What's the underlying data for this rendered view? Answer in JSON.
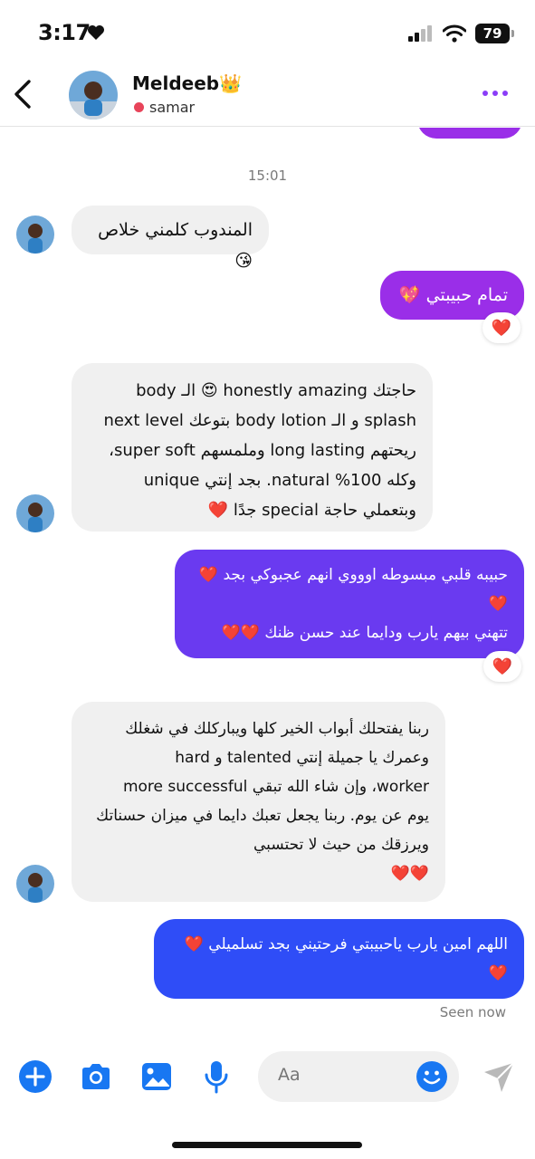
{
  "status_bar": {
    "time": "3:17",
    "battery": "79"
  },
  "header": {
    "contact_name": "Meldeeb👑",
    "contact_status": "samar",
    "accent_color": "#8b3df8"
  },
  "chat": {
    "timestamp": "15:01",
    "messages": [
      {
        "direction": "incoming",
        "lines": [
          "المندوب كلمني خلاص 😘"
        ]
      },
      {
        "direction": "outgoing",
        "lines": [
          "تمام حبيبتي 💖"
        ],
        "reaction": "❤️"
      },
      {
        "direction": "incoming",
        "lines": [
          "حاجتك honestly amazing 😍 الـ body",
          "splash و الـ body lotion بتوعك next level",
          "ريحتهم long lasting وملمسهم super soft،",
          "وكله 100% natural. بجد إنتي unique",
          "وبتعملي حاجة special جدًا ❤️"
        ]
      },
      {
        "direction": "outgoing",
        "lines": [
          "حبيبه قلبي مبسوطه اوووي انهم عجبوكي بجد ❤️",
          "❤️",
          "تتهني بيهم يارب ودايما عند حسن ظنك ❤️❤️"
        ],
        "reaction": "❤️"
      },
      {
        "direction": "incoming",
        "lines": [
          "ربنا يفتحلك أبواب الخير كلها ويباركلك في شغلك",
          "وعمرك يا جميلة إنتي talented و hard",
          "worker، وإن شاء الله تبقي more successful",
          "يوم عن يوم. ربنا يجعل تعبك دايما في ميزان حسناتك",
          "ويرزقك من حيث لا تحتسبي",
          "❤️❤️"
        ]
      },
      {
        "direction": "outgoing",
        "lines": [
          "اللهم امين يارب ياحبيبتي فرحتيني بجد تسلميلي ❤️",
          "❤️"
        ]
      }
    ],
    "seen_label": "Seen now"
  },
  "composer": {
    "placeholder": "Aa",
    "icons": [
      "plus-icon",
      "camera-icon",
      "gallery-icon",
      "microphone-icon",
      "emoji-icon",
      "send-icon"
    ],
    "icon_color": "#1877f2"
  },
  "colors": {
    "outgoing_1": "#9a2ee8",
    "outgoing_2": "#6a3af0",
    "outgoing_3": "#2f4df7",
    "incoming": "#f0f0f0"
  }
}
